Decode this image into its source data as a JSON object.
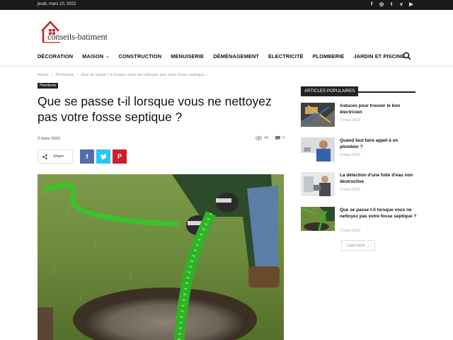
{
  "topbar": {
    "date": "jeudi, mars 10, 2022",
    "social_icons": [
      "facebook-icon",
      "instagram-icon",
      "twitter-icon",
      "vimeo-icon",
      "youtube-icon"
    ]
  },
  "logo": {
    "text": "conseils-batiment"
  },
  "nav": {
    "items": [
      "DÉCORATION",
      "MAISON",
      "CONSTRUCTION",
      "MENUISERIE",
      "DÉMÉNAGEMENT",
      "ELECTRICITÉ",
      "PLOMBERIE",
      "JARDIN ET PISCINE"
    ]
  },
  "breadcrumb": {
    "home": "Home",
    "sep": "›",
    "category": "Plomberie",
    "current": "Que se passe t-il lorsque vous ne nettoyez pas votre fosse septique..."
  },
  "article": {
    "category": "Plomberie",
    "title": "Que se passe t-il lorsque vous ne nettoyez pas votre fosse septique ?",
    "date": "2 mars 2022",
    "views": "46",
    "comments": "0",
    "share_label": "Share"
  },
  "sidebar": {
    "heading": "ARTICLES POPULAIRES",
    "items": [
      {
        "title": "Astuces pour trouver le bon électricien",
        "date": "7 mars 2022"
      },
      {
        "title": "Quand faut faire appel à un plombier ?",
        "date": "4 mars 2022"
      },
      {
        "title": "La détection d'une fuite d'eau non destructive",
        "date": "4 mars 2022"
      },
      {
        "title": "Que se passe t-il lorsque vous ne nettoyez pas votre fosse septique ?",
        "date": "2 mars 2022"
      }
    ],
    "load_more": "Load more"
  },
  "colors": {
    "topbar": "#1a1a1a",
    "facebook": "#516eab",
    "twitter": "#29c5f6",
    "pinterest": "#ca212a",
    "logo_red": "#c0272d"
  }
}
